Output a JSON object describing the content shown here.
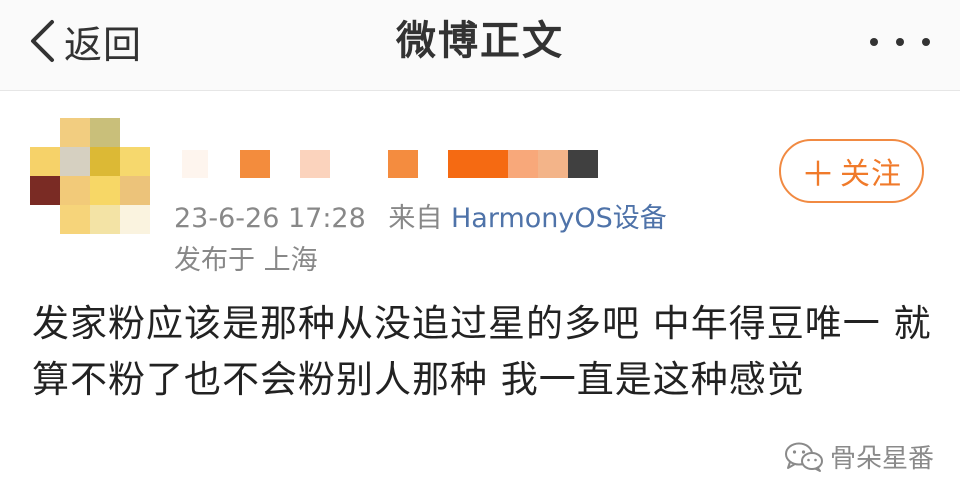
{
  "navbar": {
    "back_label": "返回",
    "title": "微博正文",
    "more_icon": "more-dots-icon"
  },
  "post": {
    "avatar_colors": [
      "#ffffff",
      "#f2cd80",
      "#c9bf7a",
      "#ffffff",
      "#f6d269",
      "#d6d0c1",
      "#dcb935",
      "#f6d86d",
      "#7a2b24",
      "#f2ca79",
      "#f7d766",
      "#ecc37a",
      "#ffffff",
      "#f6d47a",
      "#f3e3a5",
      "#faf3df"
    ],
    "username_mosaic_colors": [
      "#fef5ee",
      "#ffffff",
      "#f38c3d",
      "#ffffff",
      "#fbd3bd",
      "#ffffff",
      "#f48c3f",
      "#ffffff",
      "#f56a12",
      "#f8a87a",
      "#f3b489",
      "#404040"
    ],
    "timestamp": "23-6-26 17:28",
    "source_prefix": "来自",
    "source_device": "HarmonyOS设备",
    "location": "发布于 上海",
    "follow_label": "关注",
    "body": "发家粉应该是那种从没追过星的多吧  中年得豆唯一 就算不粉了也不会粉别人那种 我一直是这种感觉"
  },
  "watermark": {
    "text": "骨朵星番",
    "icon": "wechat-icon"
  },
  "colors": {
    "accent": "#f07a2a",
    "link": "#4f73a9",
    "meta": "#888888"
  }
}
